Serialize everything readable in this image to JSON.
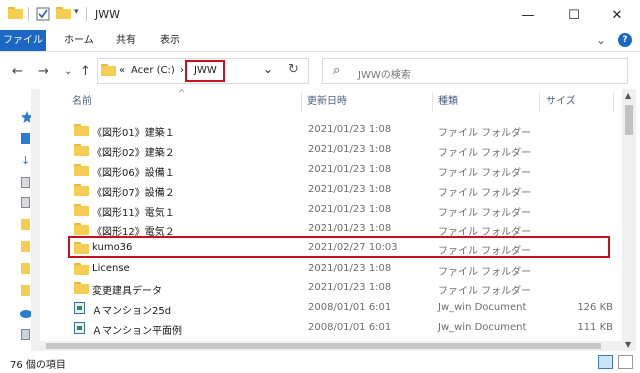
{
  "window": {
    "title": "JWW",
    "minimize": "—",
    "maximize": "☐",
    "close": "✕"
  },
  "ribbon": {
    "file_tab": "ファイル",
    "tabs": [
      "ホーム",
      "共有",
      "表示"
    ],
    "expand": "⌄",
    "help": "?"
  },
  "address": {
    "back": "←",
    "forward": "→",
    "recent": "⌄",
    "up": "↑",
    "chevron": "«",
    "drive": "Acer (C:)",
    "separator": "›",
    "current": "JWW",
    "dropdown": "⌄",
    "refresh": "↻",
    "search_placeholder": "JWWの検索",
    "search_icon": "⌕"
  },
  "columns": {
    "name": "名前",
    "date": "更新日時",
    "kind": "種類",
    "size": "サイズ"
  },
  "files": [
    {
      "name": "《図形01》建築１",
      "date": "2021/01/23 1:08",
      "kind": "ファイル フォルダー",
      "size": "",
      "icon": "folder-icon"
    },
    {
      "name": "《図形02》建築２",
      "date": "2021/01/23 1:08",
      "kind": "ファイル フォルダー",
      "size": "",
      "icon": "folder-icon"
    },
    {
      "name": "《図形06》設備１",
      "date": "2021/01/23 1:08",
      "kind": "ファイル フォルダー",
      "size": "",
      "icon": "folder-icon"
    },
    {
      "name": "《図形07》設備２",
      "date": "2021/01/23 1:08",
      "kind": "ファイル フォルダー",
      "size": "",
      "icon": "folder-icon"
    },
    {
      "name": "《図形11》電気１",
      "date": "2021/01/23 1:08",
      "kind": "ファイル フォルダー",
      "size": "",
      "icon": "folder-icon"
    },
    {
      "name": "《図形12》電気２",
      "date": "2021/01/23 1:08",
      "kind": "ファイル フォルダー",
      "size": "",
      "icon": "folder-icon"
    },
    {
      "name": "kumo36",
      "date": "2021/02/27 10:03",
      "kind": "ファイル フォルダー",
      "size": "",
      "icon": "folder-icon"
    },
    {
      "name": "License",
      "date": "2021/01/23 1:08",
      "kind": "ファイル フォルダー",
      "size": "",
      "icon": "folder-icon"
    },
    {
      "name": "変更建具データ",
      "date": "2021/01/23 1:08",
      "kind": "ファイル フォルダー",
      "size": "",
      "icon": "folder-icon"
    },
    {
      "name": "Ａマンション25d",
      "date": "2008/01/01 6:01",
      "kind": "Jw_win Document",
      "size": "126 KB",
      "icon": "jw-document-icon"
    },
    {
      "name": "Ａマンション平面例",
      "date": "2008/01/01 6:01",
      "kind": "Jw_win Document",
      "size": "111 KB",
      "icon": "jw-document-icon"
    }
  ],
  "status": {
    "item_count": "76 個の項目"
  },
  "colors": {
    "file_tab": "#1c67c4",
    "highlight": "#c8101e",
    "folder": "#f6cd53"
  }
}
